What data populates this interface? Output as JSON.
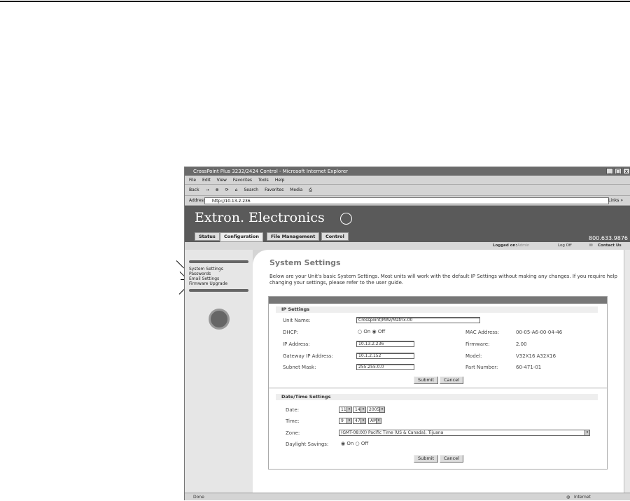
{
  "window": {
    "title": "CrossPoint Plus 3232/2424 Control - Microsoft Internet Explorer",
    "min": "_",
    "max": "□",
    "close": "x"
  },
  "menu": [
    "File",
    "Edit",
    "View",
    "Favorites",
    "Tools",
    "Help"
  ],
  "toolbar": [
    "Back",
    "→",
    "Search",
    "Favorites",
    "Media"
  ],
  "address": {
    "label": "Address",
    "url": "http://10.13.2.236",
    "links": "Links »"
  },
  "header": {
    "brand": "Extron. Electronics",
    "phone": "800.633.9876",
    "tabs": [
      "Status",
      "Configuration",
      "File Management",
      "Control"
    ],
    "logged_on": "Logged on:",
    "user": "Admin",
    "logoff": "Log Off",
    "contact": "Contact Us"
  },
  "sidebar": {
    "items": [
      "System Settings",
      "Passwords",
      "Email Settings",
      "Firmware Upgrade"
    ]
  },
  "page": {
    "title": "System Settings",
    "description": "Below are your Unit's basic System Settings. Most units will work with the default IP Settings without making any changes. If you require help changing your settings, please refer to the user guide."
  },
  "ip": {
    "heading": "IP Settings",
    "unit_name_label": "Unit Name:",
    "unit_name": "Crosspoint/MAV/Matrix-00",
    "dhcp_label": "DHCP:",
    "on": "On",
    "off": "Off",
    "ip_label": "IP Address:",
    "ip": "10.13.2.236",
    "gw_label": "Gateway IP Address:",
    "gw": "10.1.2.152",
    "mask_label": "Subnet Mask:",
    "mask": "255.255.0.0",
    "mac_label": "MAC Address:",
    "mac": "00-05-A6-00-04-46",
    "fw_label": "Firmware:",
    "fw": "2.00",
    "model_label": "Model:",
    "model": "V32X16 A32X16",
    "part_label": "Part Number:",
    "part": "60-471-01",
    "submit": "Submit",
    "cancel": "Cancel"
  },
  "dt": {
    "heading": "Date/Time Settings",
    "date_label": "Date:",
    "month": "11",
    "day": "14",
    "year": "2005",
    "time_label": "Time:",
    "hour": "9",
    "minute": "47",
    "ampm": "AM",
    "zone_label": "Zone:",
    "zone": "(GMT-08:00) Pacific Time (US & Canada), Tijuana",
    "dst_label": "Daylight Savings:",
    "on": "On",
    "off": "Off",
    "submit": "Submit",
    "cancel": "Cancel"
  },
  "status": {
    "left": "Done",
    "zone": "Internet"
  }
}
